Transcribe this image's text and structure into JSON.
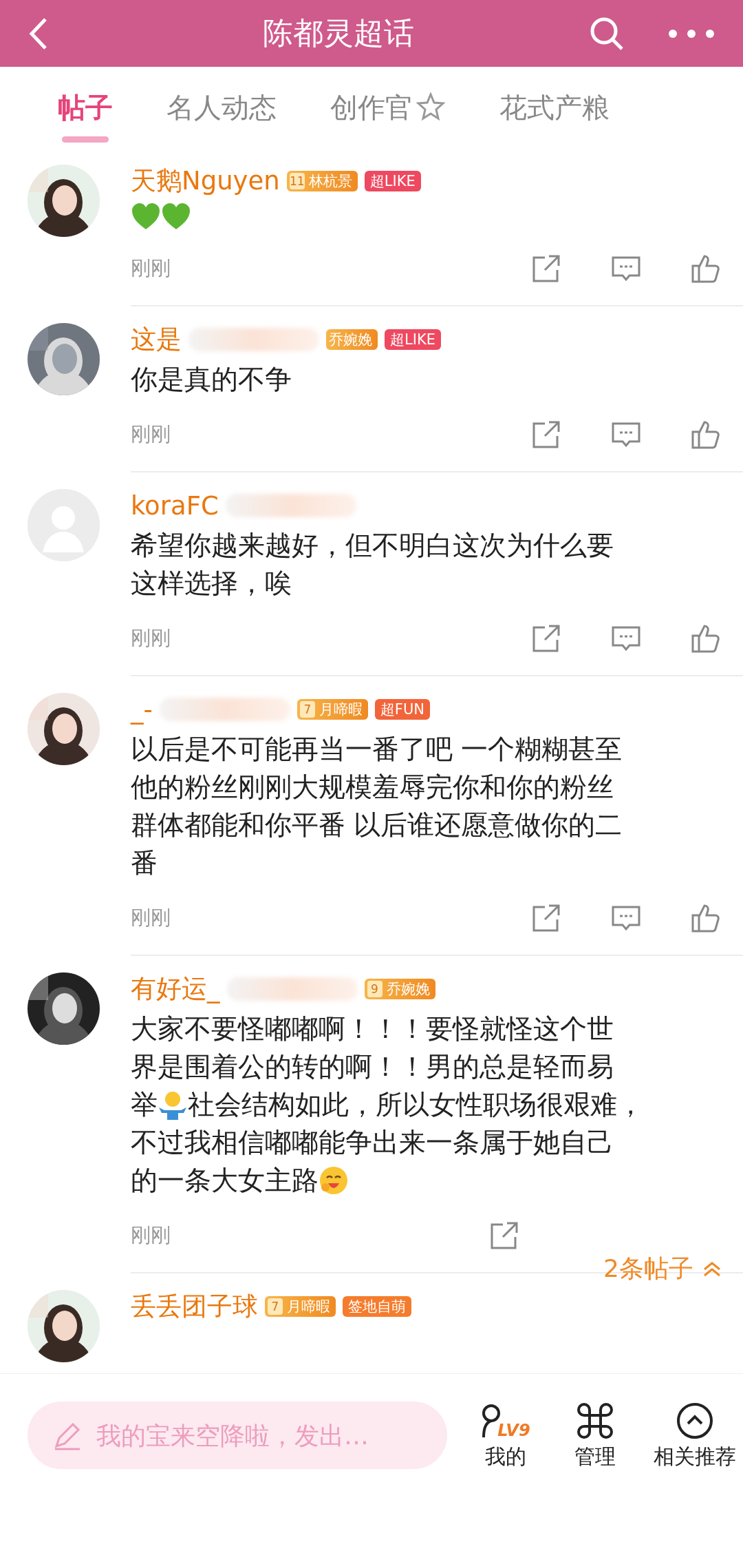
{
  "header": {
    "title": "陈都灵超话"
  },
  "tabs": [
    {
      "label": "帖子",
      "selected": true,
      "badge": false
    },
    {
      "label": "名人动态",
      "selected": false,
      "badge": false
    },
    {
      "label": "创作官",
      "selected": false,
      "badge": true
    },
    {
      "label": "花式产粮",
      "selected": false,
      "badge": false
    }
  ],
  "posts": [
    {
      "name": "天鹅Nguyen",
      "redacted": false,
      "avatar": {
        "kind": "picture"
      },
      "fan_badge": {
        "level": "11",
        "label": "林杭景"
      },
      "tag": {
        "label": "超LIKE",
        "color": "#ee4960"
      },
      "lines": [
        [
          {
            "kind": "heart"
          },
          {
            "kind": "heart"
          }
        ]
      ],
      "time": "刚刚",
      "actions": [
        {
          "kind": "share"
        },
        {
          "kind": "comment"
        },
        {
          "kind": "like"
        }
      ]
    },
    {
      "name": "这是",
      "redacted": true,
      "avatar": {
        "kind": "picture"
      },
      "fan_badge": {
        "label": "乔婉娩"
      },
      "tag": {
        "label": "超LIKE",
        "color": "#ee4960"
      },
      "lines": [
        [
          {
            "kind": "text",
            "text": "你是真的不争"
          }
        ]
      ],
      "time": "刚刚",
      "actions": [
        {
          "kind": "share"
        },
        {
          "kind": "comment"
        },
        {
          "kind": "like"
        }
      ]
    },
    {
      "name": "koraFC",
      "redacted": true,
      "avatar": {
        "kind": "default"
      },
      "lines": [
        [
          {
            "kind": "text",
            "text": "希望你越来越好，但不明白这次为什么要"
          }
        ],
        [
          {
            "kind": "text",
            "text": "这样选择，唉"
          }
        ]
      ],
      "time": "刚刚",
      "actions": [
        {
          "kind": "share"
        },
        {
          "kind": "comment"
        },
        {
          "kind": "like"
        }
      ]
    },
    {
      "name": "_-",
      "redacted": true,
      "avatar": {
        "kind": "picture"
      },
      "fan_badge": {
        "level": "7",
        "label": "月啼暇"
      },
      "tag": {
        "label": "超FUN",
        "color": "#f2643a"
      },
      "lines": [
        [
          {
            "kind": "text",
            "text": "以后是不可能再当一番了吧 一个糊糊甚至"
          }
        ],
        [
          {
            "kind": "text",
            "text": "他的粉丝刚刚大规模羞辱完你和你的粉丝"
          }
        ],
        [
          {
            "kind": "text",
            "text": "群体都能和你平番 以后谁还愿意做你的二"
          }
        ],
        [
          {
            "kind": "text",
            "text": "番"
          }
        ]
      ],
      "time": "刚刚",
      "actions": [
        {
          "kind": "share"
        },
        {
          "kind": "comment"
        },
        {
          "kind": "like"
        }
      ]
    },
    {
      "name": "有好运_",
      "redacted": true,
      "avatar": {
        "kind": "picture"
      },
      "fan_badge": {
        "level": "9",
        "label": "乔婉娩"
      },
      "lines": [
        [
          {
            "kind": "text",
            "text": "大家不要怪嘟嘟啊！！！要怪就怪这个世"
          }
        ],
        [
          {
            "kind": "text",
            "text": "界是围着公的转的啊！！男的总是轻而易"
          }
        ],
        [
          {
            "kind": "text",
            "text": "举"
          },
          {
            "kind": "shrug"
          },
          {
            "kind": "text",
            "text": "社会结构如此，所以女性职场很艰难，"
          }
        ],
        [
          {
            "kind": "text",
            "text": "不过我相信嘟嘟能争出来一条属于她自己"
          }
        ],
        [
          {
            "kind": "text",
            "text": "的一条大女主路"
          },
          {
            "kind": "hug"
          }
        ]
      ],
      "time": "刚刚",
      "actions": [
        {
          "kind": "share"
        }
      ],
      "thread_count": "2条帖子"
    },
    {
      "name": "丢丢团子球",
      "redacted": false,
      "avatar": {
        "kind": "picture"
      },
      "fan_badge": {
        "level": "7",
        "label": "月啼暇"
      },
      "tag": {
        "label": "签地自萌",
        "color": "#f57c2c"
      }
    }
  ],
  "composer": {
    "placeholder": "我的宝来空降啦，发出…"
  },
  "nav": [
    {
      "kind": "profile",
      "label": "我的",
      "level": "LV9"
    },
    {
      "kind": "manage",
      "label": "管理"
    },
    {
      "kind": "recommend",
      "label": "相关推荐"
    }
  ]
}
